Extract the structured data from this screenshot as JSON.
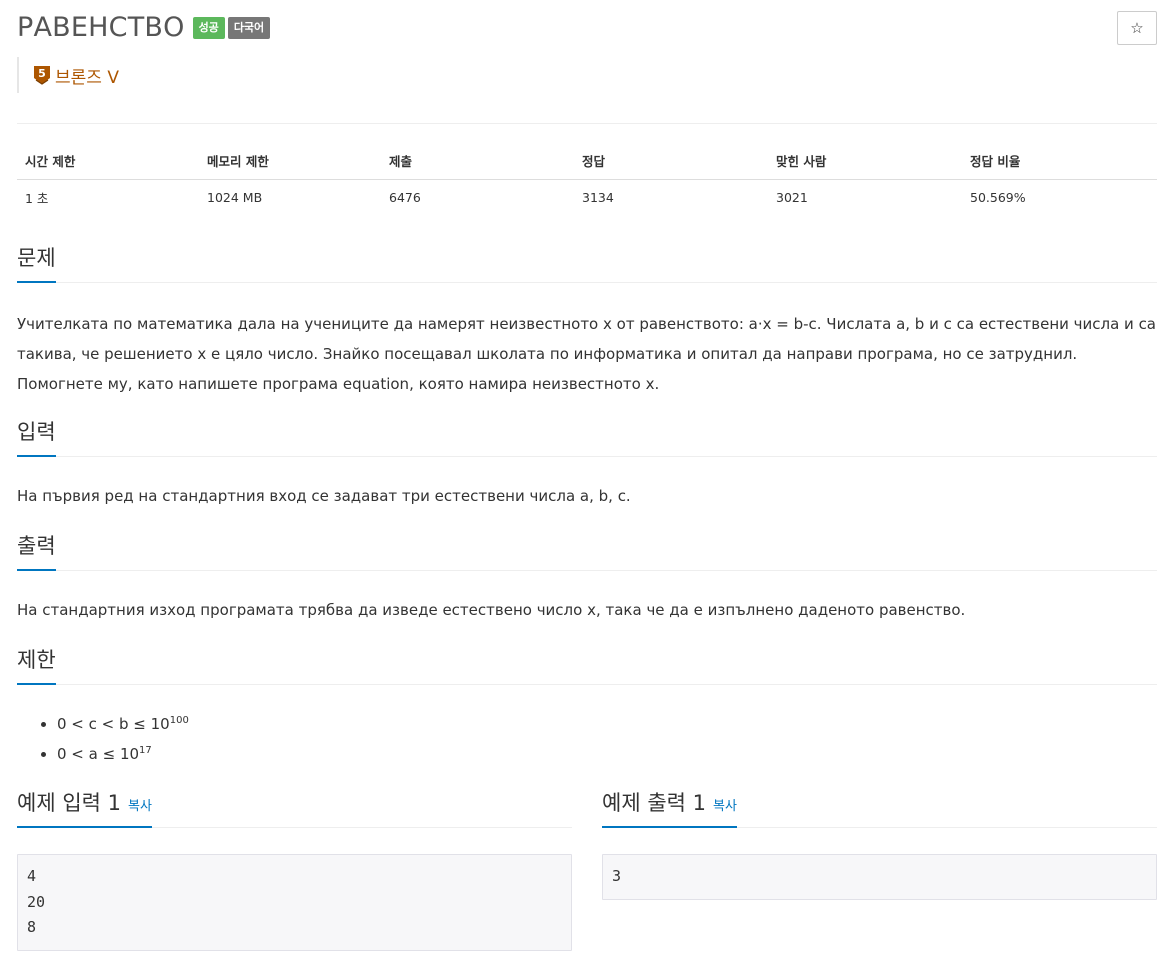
{
  "problem": {
    "title": "РАВЕНСТВО",
    "labels": {
      "success": "성공",
      "multilang": "다국어"
    },
    "tier": {
      "badge_number": "5",
      "name": "브론즈 V",
      "color": "#ad5600"
    },
    "star_icon": "☆"
  },
  "info": {
    "headers": [
      "시간 제한",
      "메모리 제한",
      "제출",
      "정답",
      "맞힌 사람",
      "정답 비율"
    ],
    "values": [
      "1 초",
      "1024 MB",
      "6476",
      "3134",
      "3021",
      "50.569%"
    ]
  },
  "sections": {
    "description": {
      "title": "문제",
      "text": "Учителката по математика дала на учениците да намерят неизвестното x от равенството: a·x = b-c. Числата a, b и c са естествени числа и са такива, че решението x е цяло число. Знайко посещавал школата по информатика и опитал да направи програма, но се затруднил. Помогнете му, като напишете програма equation, която намира неизвестното x."
    },
    "input": {
      "title": "입력",
      "text": "На първия ред на стандартния вход се задават три естествени числа a, b, c."
    },
    "output": {
      "title": "출력",
      "text": "На стандартния изход програмата трябва да изведе естествено число x, така че да е изпълнено даденото равенство."
    },
    "limits": {
      "title": "제한",
      "items": [
        {
          "base": "0 < c < b ≤ 10",
          "exp": "100"
        },
        {
          "base": "0 < a ≤ 10",
          "exp": "17"
        }
      ]
    }
  },
  "samples": {
    "input": {
      "title": "예제 입력 1",
      "copy_label": "복사",
      "content": "4\n20\n8"
    },
    "output": {
      "title": "예제 출력 1",
      "copy_label": "복사",
      "content": "3"
    }
  },
  "colors": {
    "accent": "#0076c0",
    "success": "#5cb85c",
    "label_gray": "#777777",
    "bronze": "#ad5600"
  }
}
